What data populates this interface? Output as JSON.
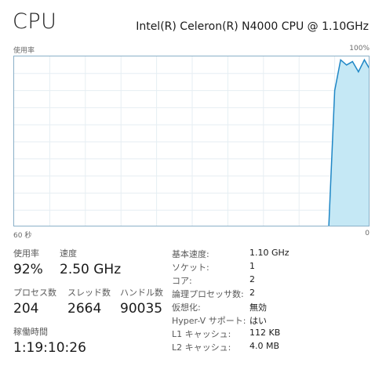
{
  "header": {
    "title": "CPU",
    "cpu_name": "Intel(R) Celeron(R) N4000 CPU @ 1.10GHz"
  },
  "graph": {
    "y_label": "使用率",
    "y_max_label": "100%",
    "x_left_label": "60 秒",
    "x_right_label": "0",
    "fill_color": "#c5e8f5",
    "line_color": "#1f87c6",
    "grid_color": "#e6eef3"
  },
  "chart_data": {
    "type": "area",
    "x_range_seconds": [
      60,
      0
    ],
    "y_range": [
      0,
      100
    ],
    "series": [
      {
        "x": [
          7.0,
          6.0,
          5.0,
          4.0,
          3.0,
          2.0,
          1.0,
          0.0
        ],
        "values": [
          0,
          80,
          98,
          95,
          97,
          91,
          98,
          92
        ]
      }
    ]
  },
  "stats": {
    "usage": {
      "label": "使用率",
      "value": "92%"
    },
    "speed": {
      "label": "速度",
      "value": "2.50 GHz"
    },
    "processes": {
      "label": "プロセス数",
      "value": "204"
    },
    "threads": {
      "label": "スレッド数",
      "value": "2664"
    },
    "handles": {
      "label": "ハンドル数",
      "value": "90035"
    },
    "uptime": {
      "label": "稼働時間",
      "value": "1:19:10:26"
    }
  },
  "details": [
    {
      "key": "基本速度:",
      "value": "1.10 GHz"
    },
    {
      "key": "ソケット:",
      "value": "1"
    },
    {
      "key": "コア:",
      "value": "2"
    },
    {
      "key": "論理プロセッサ数:",
      "value": "2"
    },
    {
      "key": "仮想化:",
      "value": "無効"
    },
    {
      "key": "Hyper-V サポート:",
      "value": "はい"
    },
    {
      "key": "L1 キャッシュ:",
      "value": "112 KB"
    },
    {
      "key": "L2 キャッシュ:",
      "value": "4.0 MB"
    }
  ]
}
